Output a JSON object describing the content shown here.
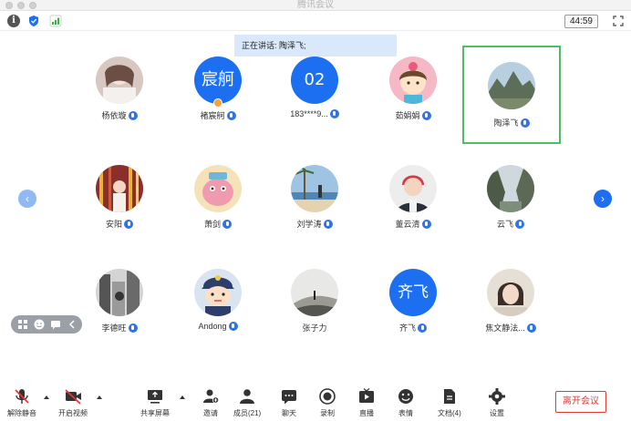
{
  "window": {
    "title": "腾讯会议"
  },
  "status": {
    "timer": "44:59",
    "info_icon": "info-icon",
    "shield_icon": "shield-icon",
    "signal_icon": "signal-icon"
  },
  "speaking": {
    "text": "正在讲话: 陶泽飞;"
  },
  "participants": [
    {
      "name": "杨依璇",
      "avatar": "photo"
    },
    {
      "name": "褚宸舸",
      "avatar_text": "宸舸",
      "host": true
    },
    {
      "name": "183****9...",
      "avatar_text": "02"
    },
    {
      "name": "茹娟娟",
      "avatar": "cartoon"
    },
    {
      "name": "陶泽飞",
      "avatar": "photo",
      "active": true
    },
    {
      "name": "安阳",
      "avatar": "photo"
    },
    {
      "name": "萧剑",
      "avatar": "cartoon"
    },
    {
      "name": "刘学涛",
      "avatar": "photo"
    },
    {
      "name": "董云清",
      "avatar": "photo"
    },
    {
      "name": "云飞",
      "avatar": "photo"
    },
    {
      "name": "李德旺",
      "avatar": "photo"
    },
    {
      "name": "Andong",
      "avatar": "cartoon"
    },
    {
      "name": "张子力",
      "avatar": "photo",
      "no_mic": true
    },
    {
      "name": "齐飞",
      "avatar_text": "齐飞"
    },
    {
      "name": "焦文静法...",
      "avatar": "photo"
    }
  ],
  "toolbar": {
    "unmute": "解除静音",
    "start_video": "开启视频",
    "share_screen": "共享屏幕",
    "invite": "邀请",
    "members": "成员(21)",
    "chat": "聊天",
    "record": "录制",
    "live": "直播",
    "reactions": "表情",
    "docs": "文档(4)",
    "settings": "设置",
    "leave": "离开会议"
  },
  "colors": {
    "accent": "#1b6ff0",
    "active_border": "#4cbf63",
    "leave": "#e53935",
    "banner": "#d9e8fb"
  }
}
